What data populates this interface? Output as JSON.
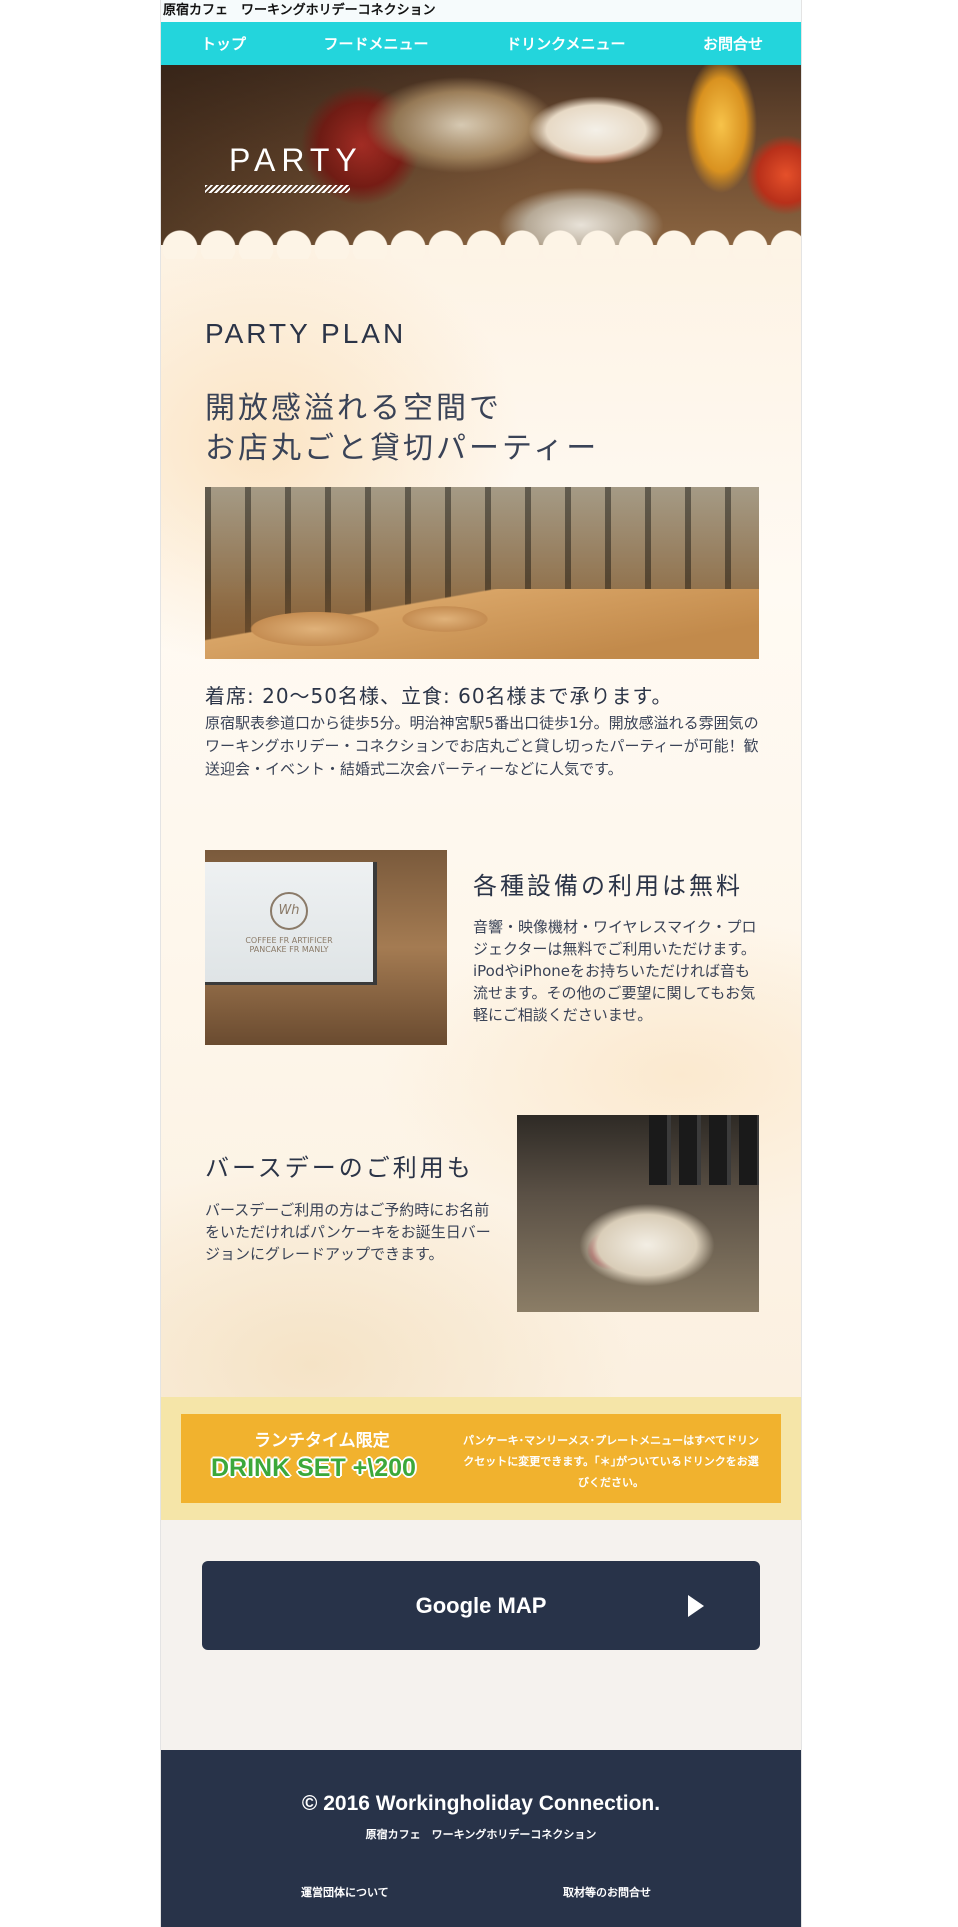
{
  "site_title": "原宿カフェ　ワーキングホリデーコネクション",
  "nav": {
    "items": [
      {
        "label": "トップ"
      },
      {
        "label": "フードメニュー"
      },
      {
        "label": "ドリンクメニュー"
      },
      {
        "label": "お問合せ"
      }
    ],
    "color": "#23d5dc"
  },
  "hero": {
    "title": "PARTY"
  },
  "party_plan": {
    "heading": "PARTY PLAN",
    "catch_line1": "開放感溢れる空間で",
    "catch_line2": "お店丸ごと貸切パーティー",
    "capacity": "着席: 20〜50名様、立食: 60名様まで承ります。",
    "access": "原宿駅表参道口から徒歩5分。明治神宮駅5番出口徒歩1分。開放感溢れる雰囲気のワーキングホリデー・コネクションでお店丸ごと貸し切ったパーティーが可能！歓送迎会・イベント・結婚式二次会パーティーなどに人気です。"
  },
  "equipment": {
    "title": "各種設備の利用は無料",
    "body": "音響・映像機材・ワイヤレスマイク・プロジェクターは無料でご利用いただけます。iPodやiPhoneをお持ちいただければ音も流せます。その他のご要望に関してもお気軽にご相談くださいませ。",
    "screen_logo": "Wh",
    "screen_line1": "COFFEE FR ARTIFICER",
    "screen_line2": "PANCAKE FR MANLY"
  },
  "birthday": {
    "title": "バースデーのご利用も",
    "body": "バースデーご利用の方はご予約時にお名前をいただければパンケーキをお誕生日バージョンにグレードアップできます。"
  },
  "lunch": {
    "label": "ランチタイム限定",
    "drink_set": "DRINK SET +\\200",
    "note": "パンケーキ･マンリーメス･プレートメニューはすべてドリンクセットに変更できます。｢＊｣がついているドリンクをお選びください。"
  },
  "map_button": {
    "label": "Google MAP"
  },
  "footer": {
    "copyright": "© 2016 Workingholiday Connection.",
    "subtitle": "原宿カフェ　ワーキングホリデーコネクション",
    "link_about": "運営団体について",
    "link_press": "取材等のお問合せ"
  },
  "colors": {
    "navy": "#283349",
    "lunch_band": "#f5e5a8",
    "lunch_box": "#f1b22e",
    "drink_set_green": "#3ca83a"
  }
}
